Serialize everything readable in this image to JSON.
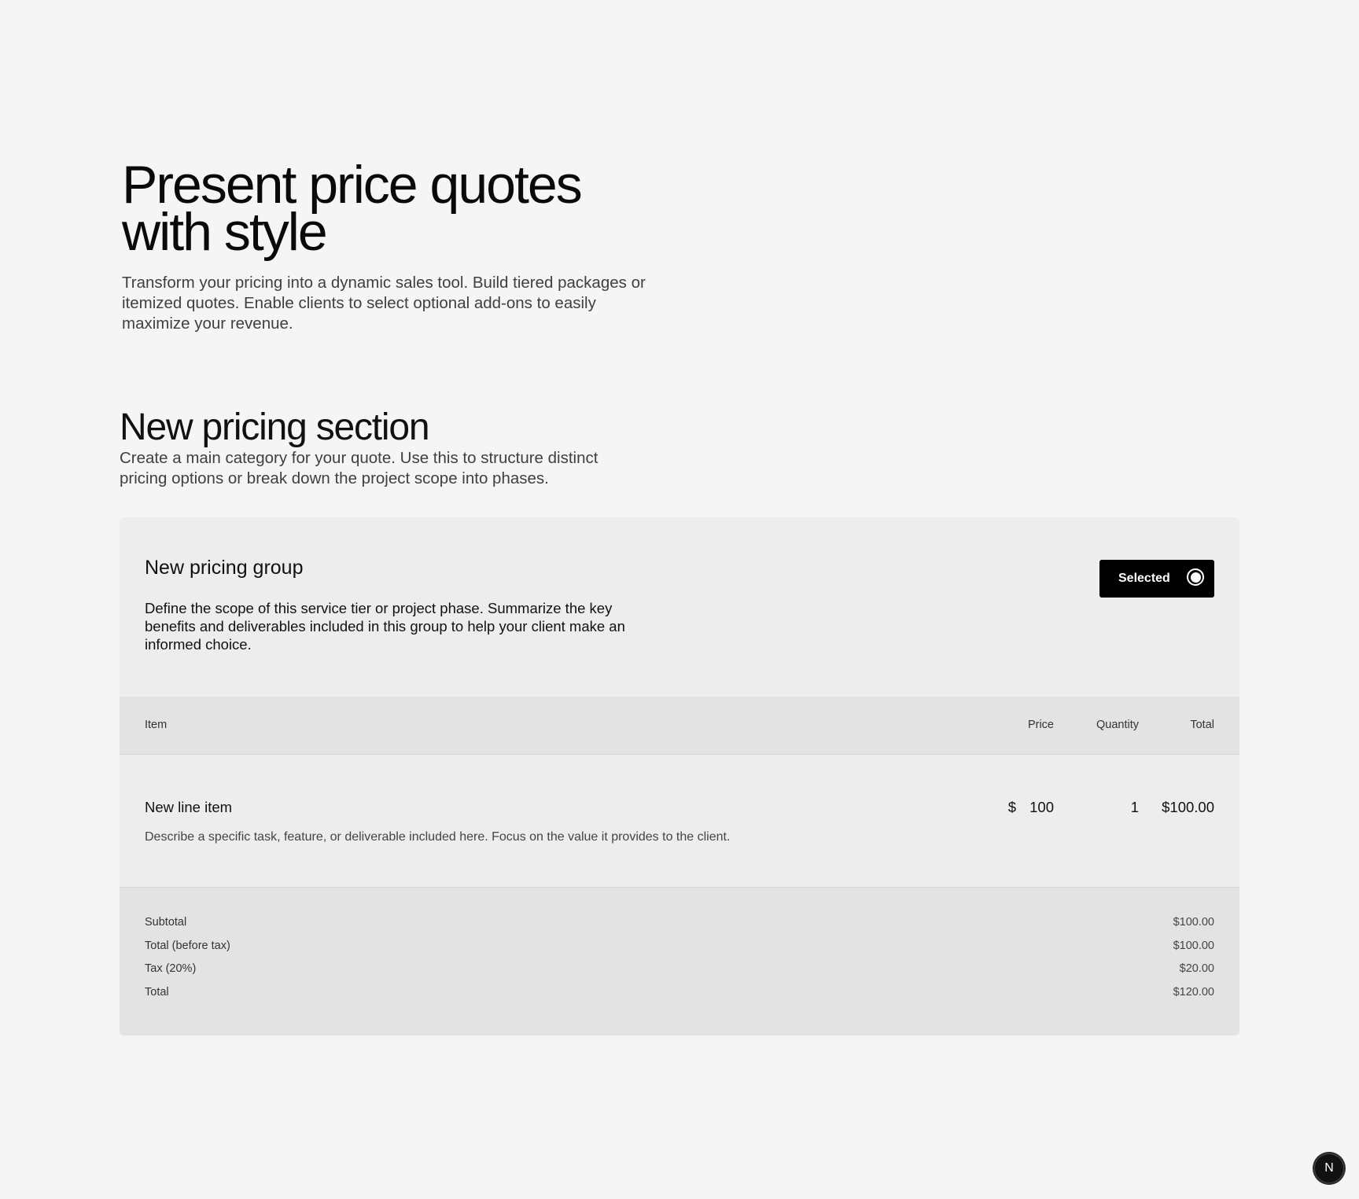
{
  "hero": {
    "title_line1": "Present price quotes",
    "title_line2": "with style",
    "subtitle": "Transform your pricing into a dynamic sales tool. Build tiered packages or itemized quotes. Enable clients to select optional add-ons to easily maximize your revenue."
  },
  "section": {
    "title": "New pricing section",
    "description": "Create a main category for your quote. Use this to structure distinct pricing options or break down the project scope into phases."
  },
  "group": {
    "title": "New pricing group",
    "description": "Define the scope of this service tier or project phase. Summarize the key benefits and deliverables included in this group to help your client make an informed choice.",
    "selected_label": "Selected",
    "selected": true
  },
  "table": {
    "headers": {
      "item": "Item",
      "price": "Price",
      "quantity": "Quantity",
      "total": "Total"
    },
    "rows": [
      {
        "name": "New line item",
        "description": "Describe a specific task, feature, or deliverable included here. Focus on the value it provides to the client.",
        "currency": "$",
        "price": "100",
        "quantity": "1",
        "total": "$100.00"
      }
    ]
  },
  "summary": {
    "subtotal_label": "Subtotal",
    "subtotal_value": "$100.00",
    "pretax_label": "Total (before tax)",
    "pretax_value": "$100.00",
    "tax_label": "Tax (20%)",
    "tax_value": "$20.00",
    "total_label": "Total",
    "total_value": "$120.00"
  },
  "badge": {
    "letter": "N",
    "icon": "nextjs-logo-icon"
  },
  "colors": {
    "background": "#f5f5f5",
    "card": "#ededed",
    "table_header": "#e3e3e3",
    "button": "#000000",
    "text": "#111111"
  }
}
